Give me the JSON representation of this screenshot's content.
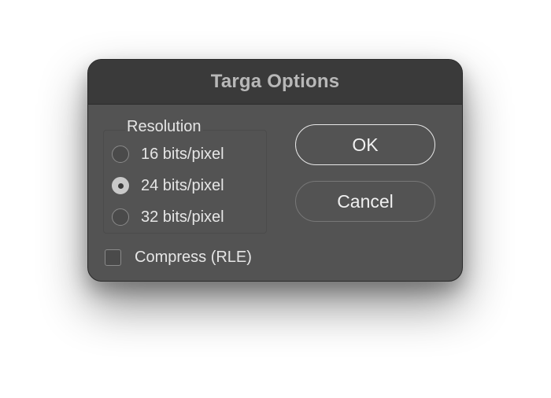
{
  "dialog": {
    "title": "Targa Options",
    "resolution": {
      "label": "Resolution",
      "options": [
        {
          "label": "16 bits/pixel",
          "selected": false
        },
        {
          "label": "24 bits/pixel",
          "selected": true
        },
        {
          "label": "32 bits/pixel",
          "selected": false
        }
      ]
    },
    "compress": {
      "label": "Compress (RLE)",
      "checked": false
    },
    "buttons": {
      "ok_label": "OK",
      "cancel_label": "Cancel"
    }
  }
}
